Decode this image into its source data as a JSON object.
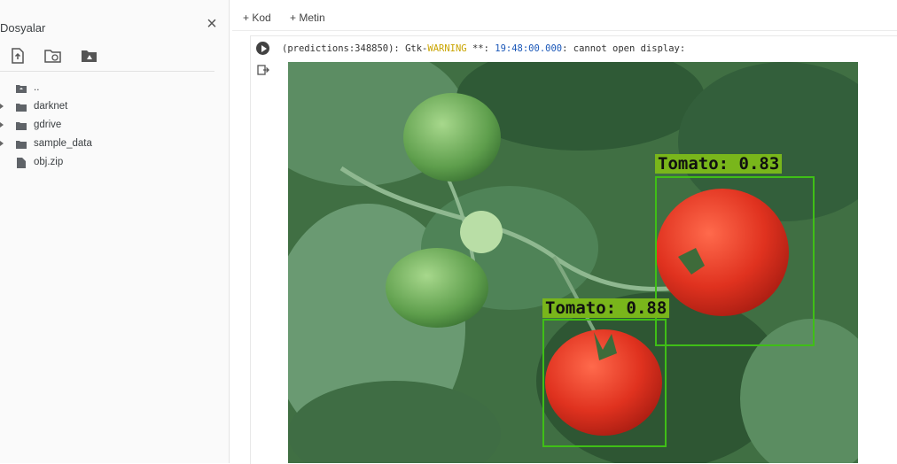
{
  "files_panel": {
    "title": "Dosyalar",
    "close_icon": "close-icon",
    "toolbar_icons": [
      "upload-file-icon",
      "refresh-folder-icon",
      "mount-drive-icon"
    ],
    "tree": [
      {
        "label": "..",
        "expandable": false,
        "icon": "folder-up-icon"
      },
      {
        "label": "darknet",
        "expandable": true,
        "icon": "folder-icon"
      },
      {
        "label": "gdrive",
        "expandable": true,
        "icon": "folder-icon"
      },
      {
        "label": "sample_data",
        "expandable": true,
        "icon": "folder-icon"
      },
      {
        "label": "obj.zip",
        "expandable": false,
        "icon": "file-icon"
      }
    ]
  },
  "notebook": {
    "add_code": "+ Kod",
    "add_text": "+ Metin",
    "output_prefix": "(predictions:348850): Gtk-",
    "output_warning": "WARNING",
    "output_mid": " **: ",
    "output_time": "19:48:00.000",
    "output_suffix": ": cannot open display:"
  },
  "detections": [
    {
      "label": "Tomato: 0.83"
    },
    {
      "label": "Tomato: 0.88"
    }
  ],
  "colors": {
    "box": "#3fbf16",
    "label_bg": "#79b61b",
    "warning": "#c9a400",
    "time": "#1a57b8"
  }
}
